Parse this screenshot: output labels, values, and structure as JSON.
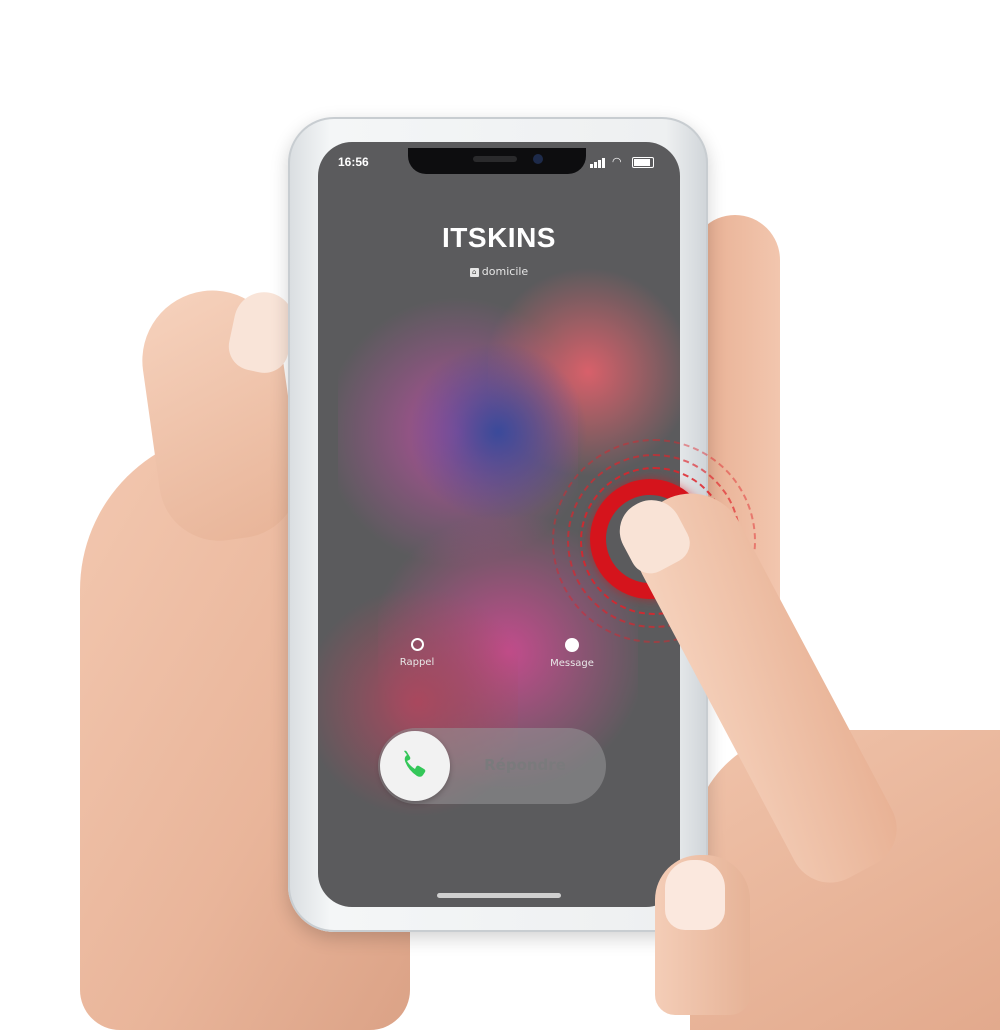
{
  "status_bar": {
    "time": "16:56",
    "wifi_icon": "wifi-icon",
    "signal_icon": "signal-icon",
    "battery_icon": "battery-icon"
  },
  "call": {
    "caller_name": "ITSKINS",
    "caller_label": "domicile",
    "caller_label_icon": "home-icon"
  },
  "actions": {
    "remind": {
      "label": "Rappel",
      "icon": "alarm-icon"
    },
    "message": {
      "label": "Message",
      "icon": "message-bubble-icon"
    }
  },
  "answer_slider": {
    "label": "Répondre",
    "knob_icon": "phone-icon",
    "knob_icon_color": "#34c759"
  },
  "colors": {
    "accent_red": "#d5141c"
  }
}
